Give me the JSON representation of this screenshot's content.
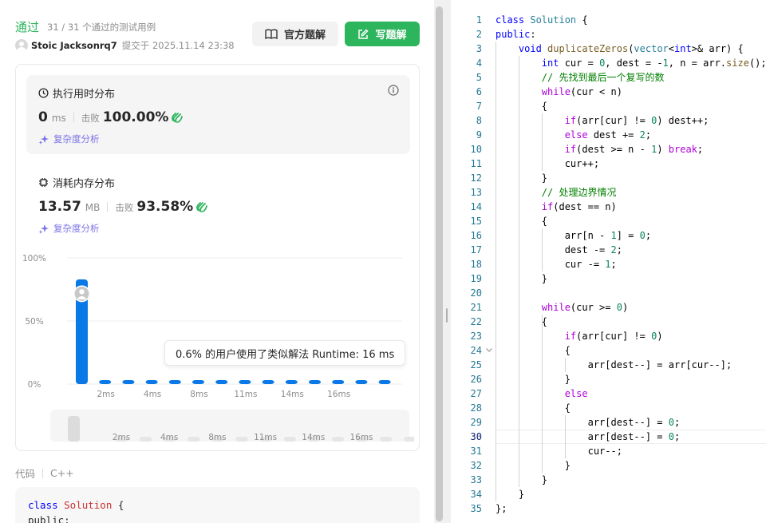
{
  "submission": {
    "status": "通过",
    "tests": "31 / 31 个通过的测试用例",
    "user": "Stoic Jacksonrq7",
    "submitted": "提交于 2025.11.14 23:38",
    "btn_solution": "官方题解",
    "btn_write": "写题解"
  },
  "runtime": {
    "title": "执行用时分布",
    "value": "0",
    "unit": "ms",
    "beat_label": "击败",
    "beat_pct": "100.00%",
    "complexity": "复杂度分析"
  },
  "memory": {
    "title": "消耗内存分布",
    "value": "13.57",
    "unit": "MB",
    "beat_label": "击败",
    "beat_pct": "93.58%",
    "complexity": "复杂度分析"
  },
  "tooltip": "0.6% 的用户使用了类似解法 Runtime: 16 ms",
  "code_label": "代码",
  "language": "C++",
  "preview": [
    "class Solution {",
    "public:"
  ],
  "chart_data": {
    "type": "bar",
    "y_ticks": [
      "100%",
      "50%",
      "0%"
    ],
    "x_tick_labels": [
      "2ms",
      "4ms",
      "8ms",
      "11ms",
      "14ms",
      "16ms"
    ],
    "ylim": [
      0,
      100
    ],
    "values": [
      83,
      0.6,
      0.6,
      0.6,
      0.6,
      0.6,
      0.6,
      0.6,
      0.6,
      0.6,
      0.6,
      0.6,
      0.6,
      0.6
    ],
    "highlight_index": 0,
    "bar_color": "#0a78e6",
    "grid": true
  },
  "editor": {
    "active_line": 30,
    "lines": [
      [
        [
          "kw",
          "class "
        ],
        [
          "ty",
          "Solution"
        ],
        [
          "pn",
          " {"
        ]
      ],
      [
        [
          "kw",
          "public"
        ],
        [
          "pn",
          ":"
        ]
      ],
      [
        [
          "pn",
          "    "
        ],
        [
          "kw",
          "void "
        ],
        [
          "fn",
          "duplicateZeros"
        ],
        [
          "pn",
          "("
        ],
        [
          "ty",
          "vector"
        ],
        [
          "pn",
          "<"
        ],
        [
          "kw",
          "int"
        ],
        [
          "pn",
          ">& arr) {"
        ]
      ],
      [
        [
          "pn",
          "        "
        ],
        [
          "kw",
          "int"
        ],
        [
          "pn",
          " cur = "
        ],
        [
          "num",
          "0"
        ],
        [
          "pn",
          ", dest = -"
        ],
        [
          "num",
          "1"
        ],
        [
          "pn",
          ", n = arr."
        ],
        [
          "fn",
          "size"
        ],
        [
          "pn",
          "();"
        ]
      ],
      [
        [
          "pn",
          "        "
        ],
        [
          "cm",
          "// 先找到最后一个复写的数"
        ]
      ],
      [
        [
          "pn",
          "        "
        ],
        [
          "ctl",
          "while"
        ],
        [
          "pn",
          "(cur < n)"
        ]
      ],
      [
        [
          "pn",
          "        {"
        ]
      ],
      [
        [
          "pn",
          "            "
        ],
        [
          "ctl",
          "if"
        ],
        [
          "pn",
          "(arr[cur] != "
        ],
        [
          "num",
          "0"
        ],
        [
          "pn",
          ") dest++;"
        ]
      ],
      [
        [
          "pn",
          "            "
        ],
        [
          "ctl",
          "else"
        ],
        [
          "pn",
          " dest += "
        ],
        [
          "num",
          "2"
        ],
        [
          "pn",
          ";"
        ]
      ],
      [
        [
          "pn",
          "            "
        ],
        [
          "ctl",
          "if"
        ],
        [
          "pn",
          "(dest >= n - "
        ],
        [
          "num",
          "1"
        ],
        [
          "pn",
          ") "
        ],
        [
          "ctl",
          "break"
        ],
        [
          "pn",
          ";"
        ]
      ],
      [
        [
          "pn",
          "            cur++;"
        ]
      ],
      [
        [
          "pn",
          "        }"
        ]
      ],
      [
        [
          "pn",
          "        "
        ],
        [
          "cm",
          "// 处理边界情况"
        ]
      ],
      [
        [
          "pn",
          "        "
        ],
        [
          "ctl",
          "if"
        ],
        [
          "pn",
          "(dest == n)"
        ]
      ],
      [
        [
          "pn",
          "        {"
        ]
      ],
      [
        [
          "pn",
          "            arr[n - "
        ],
        [
          "num",
          "1"
        ],
        [
          "pn",
          "] = "
        ],
        [
          "num",
          "0"
        ],
        [
          "pn",
          ";"
        ]
      ],
      [
        [
          "pn",
          "            dest -= "
        ],
        [
          "num",
          "2"
        ],
        [
          "pn",
          ";"
        ]
      ],
      [
        [
          "pn",
          "            cur -= "
        ],
        [
          "num",
          "1"
        ],
        [
          "pn",
          ";"
        ]
      ],
      [
        [
          "pn",
          "        }"
        ]
      ],
      [
        [
          "pn",
          ""
        ]
      ],
      [
        [
          "pn",
          "        "
        ],
        [
          "ctl",
          "while"
        ],
        [
          "pn",
          "(cur >= "
        ],
        [
          "num",
          "0"
        ],
        [
          "pn",
          ")"
        ]
      ],
      [
        [
          "pn",
          "        {"
        ]
      ],
      [
        [
          "pn",
          "            "
        ],
        [
          "ctl",
          "if"
        ],
        [
          "pn",
          "(arr[cur] != "
        ],
        [
          "num",
          "0"
        ],
        [
          "pn",
          ")"
        ]
      ],
      [
        [
          "pn",
          "            {"
        ]
      ],
      [
        [
          "pn",
          "                arr[dest--] = arr[cur--];"
        ]
      ],
      [
        [
          "pn",
          "            }"
        ]
      ],
      [
        [
          "pn",
          "            "
        ],
        [
          "ctl",
          "else"
        ]
      ],
      [
        [
          "pn",
          "            {"
        ]
      ],
      [
        [
          "pn",
          "                arr[dest--] = "
        ],
        [
          "num",
          "0"
        ],
        [
          "pn",
          ";"
        ]
      ],
      [
        [
          "pn",
          "                arr[dest--] = "
        ],
        [
          "num",
          "0"
        ],
        [
          "pn",
          ";"
        ]
      ],
      [
        [
          "pn",
          "                cur--;"
        ]
      ],
      [
        [
          "pn",
          "            }"
        ]
      ],
      [
        [
          "pn",
          "        }"
        ]
      ],
      [
        [
          "pn",
          "    }"
        ]
      ],
      [
        [
          "pn",
          "};"
        ]
      ]
    ]
  }
}
